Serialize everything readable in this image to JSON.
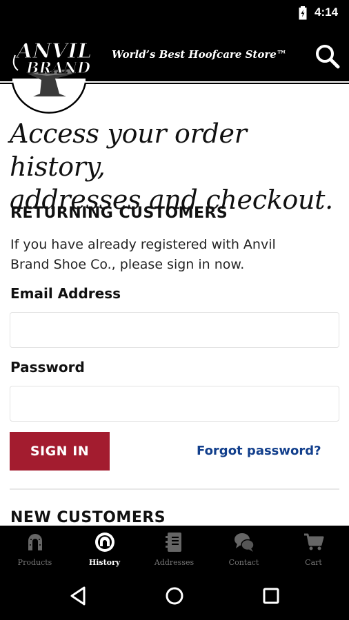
{
  "status_bar": {
    "time": "4:14"
  },
  "header": {
    "logo_text_top": "ANVIL",
    "logo_text_bottom": "BRAND",
    "tagline": "World’s Best Hoofcare Store™"
  },
  "main": {
    "headline_line1": "Access your order history,",
    "headline_line2": "addresses and checkout.",
    "returning_title": "RETURNING CUSTOMERS",
    "returning_intro_line1": "If you have already registered with Anvil",
    "returning_intro_line2": "Brand Shoe Co., please sign in now.",
    "email_label": "Email Address",
    "email_value": "",
    "password_label": "Password",
    "password_value": "",
    "sign_in_label": "SIGN IN",
    "forgot_label": "Forgot password?",
    "new_customers_title": "NEW CUSTOMERS"
  },
  "tabs": [
    {
      "label": "Products",
      "icon": "horseshoe-icon",
      "active": false
    },
    {
      "label": "History",
      "icon": "history-icon",
      "active": true
    },
    {
      "label": "Addresses",
      "icon": "address-book-icon",
      "active": false
    },
    {
      "label": "Contact",
      "icon": "chat-bubbles-icon",
      "active": false
    },
    {
      "label": "Cart",
      "icon": "cart-icon",
      "active": false
    }
  ],
  "colors": {
    "accent": "#a31c2f",
    "link": "#123f8c",
    "bar": "#000000"
  }
}
